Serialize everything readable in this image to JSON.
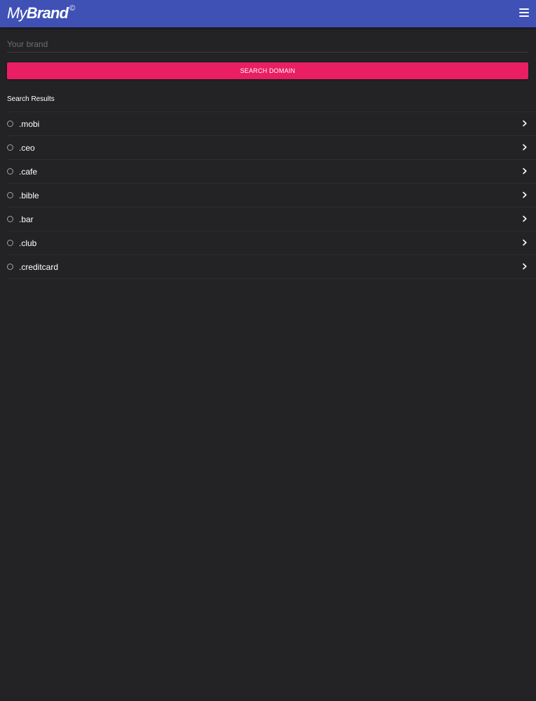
{
  "header": {
    "logo_light": "My",
    "logo_bold": "Brand",
    "logo_mark": "©",
    "menu_icon": "hamburger-menu-icon"
  },
  "search": {
    "placeholder": "Your brand",
    "value": "",
    "button_label": "SEARCH DOMAIN"
  },
  "results": {
    "title": "Search Results",
    "items": [
      {
        "label": ".mobi",
        "selected": false
      },
      {
        "label": ".ceo",
        "selected": false
      },
      {
        "label": ".cafe",
        "selected": false
      },
      {
        "label": ".bible",
        "selected": false
      },
      {
        "label": ".bar",
        "selected": false
      },
      {
        "label": ".club",
        "selected": false
      },
      {
        "label": ".creditcard",
        "selected": false
      }
    ]
  },
  "colors": {
    "app_bar": "#3f51b5",
    "accent": "#e91e63",
    "background": "#232225"
  }
}
